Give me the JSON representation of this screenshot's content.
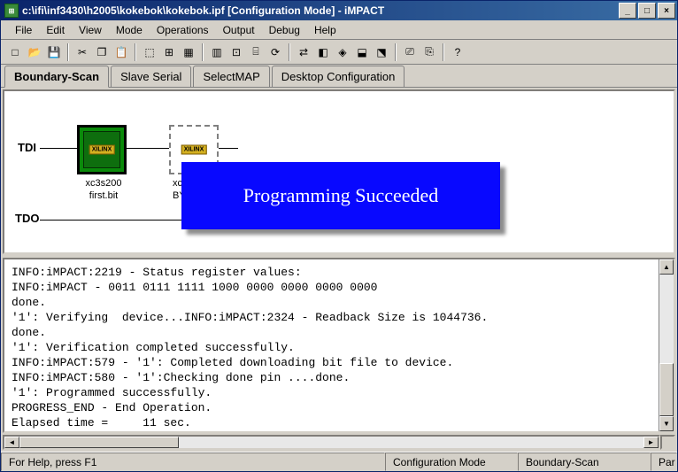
{
  "window": {
    "title": "c:\\ifi\\inf3430\\h2005\\kokebok\\kokebok.ipf [Configuration Mode]  - iMPACT"
  },
  "menu": [
    "File",
    "Edit",
    "View",
    "Mode",
    "Operations",
    "Output",
    "Debug",
    "Help"
  ],
  "tabs": [
    {
      "label": "Boundary-Scan",
      "active": true
    },
    {
      "label": "Slave Serial",
      "active": false
    },
    {
      "label": "SelectMAP",
      "active": false
    },
    {
      "label": "Desktop Configuration",
      "active": false
    }
  ],
  "scan": {
    "tdi": "TDI",
    "tdo": "TDO",
    "chip1_name": "xc3s200",
    "chip1_file": "first.bit",
    "chip2_name_prefix": "xc",
    "chip2_file_prefix": "BY",
    "chip_logo": "XILINX"
  },
  "banner": "Programming Succeeded",
  "log": "INFO:iMPACT:2219 - Status register values:\nINFO:iMPACT - 0011 0111 1111 1000 0000 0000 0000 0000\ndone.\n'1': Verifying  device...INFO:iMPACT:2324 - Readback Size is 1044736.\ndone.\n'1': Verification completed successfully.\nINFO:iMPACT:579 - '1': Completed downloading bit file to device.\nINFO:iMPACT:580 - '1':Checking done pin ....done.\n'1': Programmed successfully.\nPROGRESS_END - End Operation.\nElapsed time =     11 sec.",
  "status": {
    "help": "For Help, press F1",
    "mode": "Configuration Mode",
    "scan": "Boundary-Scan",
    "extra": "Par"
  },
  "icons": {
    "new": "□",
    "open": "📂",
    "save": "💾",
    "cut": "✂",
    "copy": "❐",
    "paste": "📋",
    "a": "⬚",
    "b": "⊞",
    "c": "▦",
    "d": "▥",
    "e": "⊡",
    "f": "⌸",
    "g": "⟳",
    "h": "⇄",
    "i": "◧",
    "j": "◈",
    "k": "⬓",
    "l": "⬔",
    "m": "⎚",
    "n": "⎘",
    "help": "?"
  }
}
